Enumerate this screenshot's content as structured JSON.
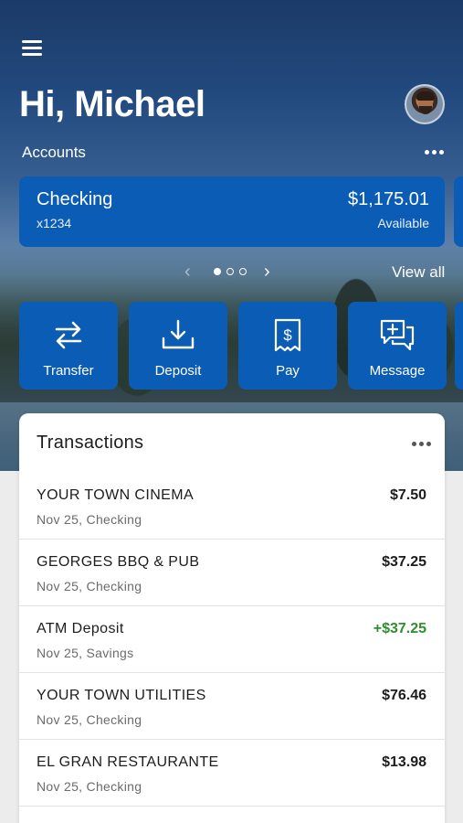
{
  "header": {
    "greeting": "Hi, Michael"
  },
  "accounts": {
    "label": "Accounts",
    "card": {
      "name": "Checking",
      "number": "x1234",
      "balance": "$1,175.01",
      "balance_label": "Available"
    },
    "pager": {
      "total": 3,
      "active": 1
    },
    "view_all": "View all"
  },
  "actions": [
    {
      "label": "Transfer",
      "icon": "transfer-arrows-icon"
    },
    {
      "label": "Deposit",
      "icon": "download-tray-icon"
    },
    {
      "label": "Pay",
      "icon": "dollar-receipt-icon"
    },
    {
      "label": "Message",
      "icon": "chat-plus-icon"
    }
  ],
  "transactions": {
    "title": "Transactions",
    "items": [
      {
        "merchant": "YOUR TOWN CINEMA",
        "meta": "Nov 25, Checking",
        "amount": "$7.50",
        "type": "debit"
      },
      {
        "merchant": "GEORGES BBQ & PUB",
        "meta": "Nov 25, Checking",
        "amount": "$37.25",
        "type": "debit"
      },
      {
        "merchant": "ATM Deposit",
        "meta": "Nov 25, Savings",
        "amount": "+$37.25",
        "type": "credit"
      },
      {
        "merchant": "YOUR TOWN UTILITIES",
        "meta": "Nov 25, Checking",
        "amount": "$76.46",
        "type": "debit"
      },
      {
        "merchant": "EL GRAN RESTAURANTE",
        "meta": "Nov 25, Checking",
        "amount": "$13.98",
        "type": "debit"
      }
    ]
  },
  "colors": {
    "brand_blue": "#0a5cb4",
    "credit_green": "#2f8f2f"
  }
}
